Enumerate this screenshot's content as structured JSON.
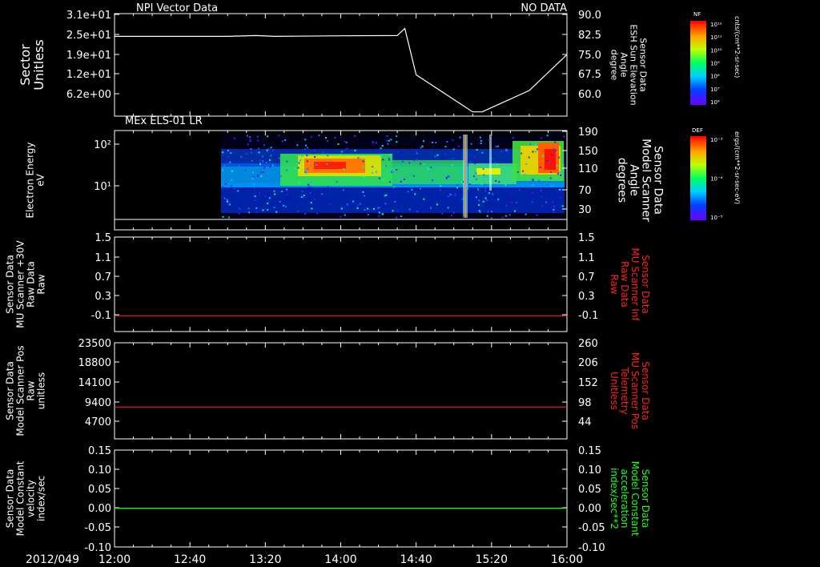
{
  "date_label": "2012/049",
  "time_ticks": [
    "12:00",
    "12:40",
    "13:20",
    "14:00",
    "14:40",
    "15:20",
    "16:00"
  ],
  "colors": {
    "background": "#000000",
    "axis": "#ffffff",
    "red_trace": "#ff2020",
    "green_trace": "#20ff20"
  },
  "colorbars": [
    {
      "tag": "NF",
      "label": "cnts/(cm**2-sr-sec)",
      "ticks": [
        "10¹²",
        "10¹¹",
        "10¹⁰",
        "10⁹",
        "10⁸",
        "10⁷",
        "10⁶"
      ]
    },
    {
      "tag": "DEF",
      "label": "ergs/(cm**2-sr-sec-eV)",
      "ticks": [
        "10⁻³",
        "10⁻⁴",
        "10⁻⁵"
      ]
    }
  ],
  "chart_data": [
    {
      "type": "line",
      "title": "NPI Vector Data",
      "status": "NO DATA",
      "left_axis": {
        "labels": [
          "Sector",
          "Unitless"
        ],
        "ticks": [
          "3.1e+01",
          "2.5e+01",
          "1.9e+01",
          "1.2e+01",
          "6.2e+00"
        ]
      },
      "right_axis": {
        "labels": [
          "Sensor Data",
          "ESH Sun Elevation",
          "Angle",
          "degree"
        ],
        "ticks": [
          "90.0",
          "82.5",
          "75.0",
          "67.5",
          "60.0"
        ],
        "ylim": [
          54,
          90
        ]
      },
      "series": [
        {
          "color": "#ffffff",
          "x": [
            "12:00",
            "13:00",
            "13:15",
            "13:25",
            "14:00",
            "14:30",
            "14:34",
            "14:40",
            "15:10",
            "15:15",
            "15:40",
            "16:00"
          ],
          "y": [
            82.0,
            82.0,
            82.3,
            82.0,
            82.2,
            82.3,
            84.8,
            68.5,
            55.5,
            55.5,
            63.0,
            75.6
          ]
        }
      ]
    },
    {
      "type": "heatmap",
      "title": "MEx ELS-01 LR",
      "left_axis": {
        "labels": [
          "Electron Energy",
          "eV"
        ],
        "ticks": [
          "10²",
          "10¹"
        ],
        "scale": "log"
      },
      "right_axis": {
        "labels": [
          "Sensor Data",
          "Model Scanner",
          "Angle",
          "degrees"
        ],
        "ticks": [
          "190",
          "150",
          "110",
          "70",
          "30"
        ]
      },
      "series": [
        {
          "color": "#ffffff",
          "x": [
            "12:00",
            "16:00"
          ],
          "y": [
            10,
            10
          ]
        }
      ]
    },
    {
      "type": "line",
      "left_axis": {
        "labels": [
          "Sensor Data",
          "MU Scanner +30V",
          "Raw Data",
          "Raw"
        ],
        "ticks": [
          "1.5",
          "1.1",
          "0.7",
          "0.3",
          "-0.1"
        ]
      },
      "right_axis": {
        "labels": [
          "Sensor Data",
          "MU Scanner Inf",
          "Raw Data",
          "Raw"
        ],
        "ticks": [
          "1.5",
          "1.1",
          "0.7",
          "0.3",
          "-0.1"
        ],
        "label_color": "#ff2020"
      },
      "ylim": [
        -0.3,
        1.5
      ],
      "series": [
        {
          "color": "#ff2020",
          "x": [
            "12:00",
            "16:00"
          ],
          "y": [
            0.0,
            0.0
          ]
        }
      ]
    },
    {
      "type": "line",
      "left_axis": {
        "labels": [
          "Sensor Data",
          "Model Scanner Pos",
          "Raw",
          "unitless"
        ],
        "ticks": [
          "23500",
          "18800",
          "14100",
          "9400",
          "4700"
        ]
      },
      "right_axis": {
        "labels": [
          "Sensor Data",
          "MU Scanner Pos",
          "Telemetry",
          "Unitless"
        ],
        "ticks": [
          "260",
          "206",
          "152",
          "98",
          "44"
        ],
        "label_color": "#ff2020"
      },
      "ylim": [
        0,
        23500
      ],
      "series": [
        {
          "color": "#ff2020",
          "x": [
            "12:00",
            "16:00"
          ],
          "y": [
            7800,
            7800
          ]
        }
      ]
    },
    {
      "type": "line",
      "left_axis": {
        "labels": [
          "Sensor Data",
          "Model Constant",
          "velocity",
          "index/sec"
        ],
        "ticks": [
          "0.15",
          "0.10",
          "0.05",
          "0.00",
          "-0.05",
          "-0.10"
        ]
      },
      "right_axis": {
        "labels": [
          "Sensor Data",
          "Model Constant",
          "acceleration",
          "index/sec**2"
        ],
        "ticks": [
          "0.15",
          "0.10",
          "0.05",
          "0.00",
          "-0.05",
          "-0.10"
        ],
        "label_color": "#20ff20"
      },
      "ylim": [
        -0.1,
        0.15
      ],
      "series": [
        {
          "color": "#20ff20",
          "x": [
            "12:00",
            "16:00"
          ],
          "y": [
            0.0,
            0.0
          ]
        }
      ]
    }
  ]
}
